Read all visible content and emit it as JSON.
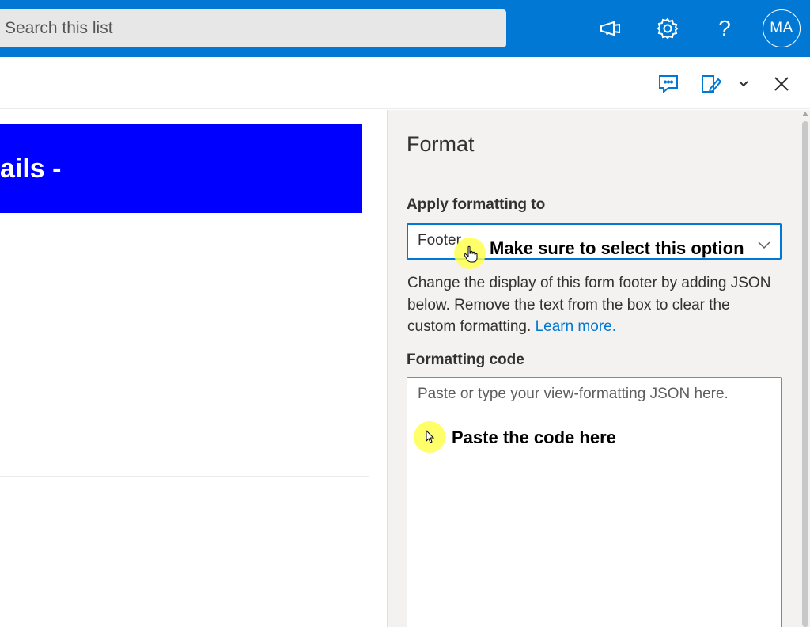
{
  "topbar": {
    "search_placeholder": "Search this list",
    "icons": [
      "megaphone-icon",
      "gear-icon",
      "help-icon"
    ],
    "avatar_initials": "MA",
    "brand_color": "#0078d4"
  },
  "command_row": {
    "icons": [
      "comment-icon",
      "edit-form-icon",
      "chevron-down-icon",
      "close-icon"
    ]
  },
  "form": {
    "header_text": "ails -",
    "header_color": "#0000ff"
  },
  "format_pane": {
    "title": "Format",
    "apply_label": "Apply formatting to",
    "apply_value": "Footer",
    "help_text": "Change the display of this form footer by adding JSON below. Remove the text from the box to clear the custom formatting. ",
    "help_link": "Learn more.",
    "code_label": "Formatting code",
    "code_placeholder": "Paste or type your view-formatting JSON here."
  },
  "annotations": {
    "select_note": "Make sure to select this option",
    "paste_note": "Paste the code here",
    "highlight_color": "#ffff50"
  }
}
